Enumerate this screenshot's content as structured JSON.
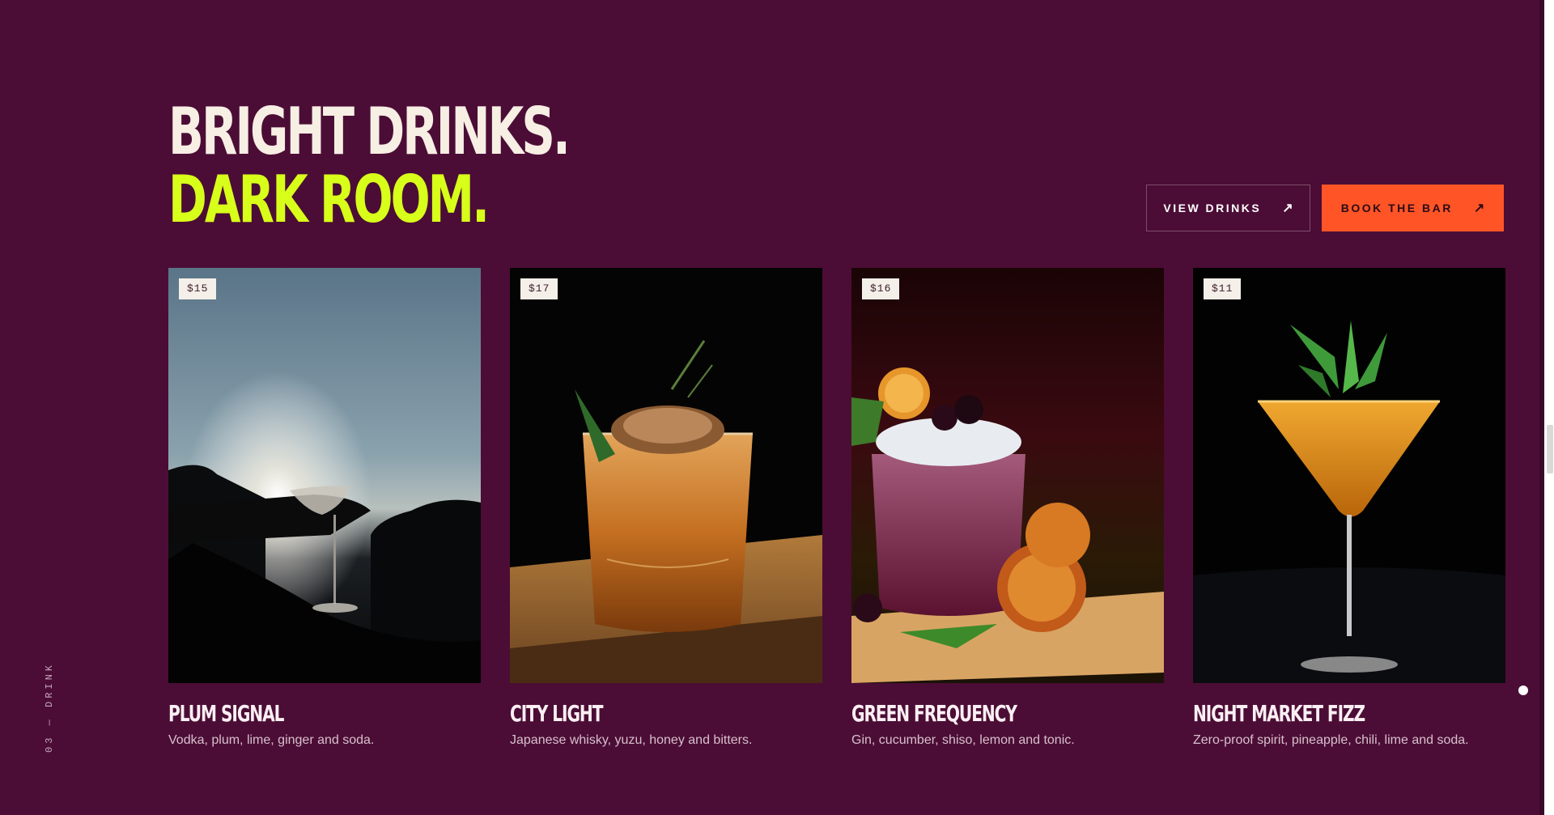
{
  "side_label": "03 — DRINK",
  "headline": {
    "line1": "BRIGHT DRINKS.",
    "line2": "DARK ROOM."
  },
  "buttons": {
    "view": {
      "label": "VIEW DRINKS",
      "icon": "arrow-up-right-icon",
      "arrow": "↗"
    },
    "book": {
      "label": "BOOK THE BAR",
      "icon": "arrow-up-right-icon",
      "arrow": "↗"
    }
  },
  "colors": {
    "background": "#4b0d35",
    "accent_lime": "#d8ff1a",
    "accent_orange": "#ff5526",
    "cream": "#f7eee4"
  },
  "drinks": [
    {
      "price": "$15",
      "name": "PLUM SIGNAL",
      "description": "Vodka, plum, lime, ginger and soda."
    },
    {
      "price": "$17",
      "name": "CITY LIGHT",
      "description": "Japanese whisky, yuzu, honey and bitters."
    },
    {
      "price": "$16",
      "name": "GREEN FREQUENCY",
      "description": "Gin, cucumber, shiso, lemon and tonic."
    },
    {
      "price": "$11",
      "name": "NIGHT MARKET FIZZ",
      "description": "Zero-proof spirit, pineapple, chili, lime and soda."
    }
  ]
}
